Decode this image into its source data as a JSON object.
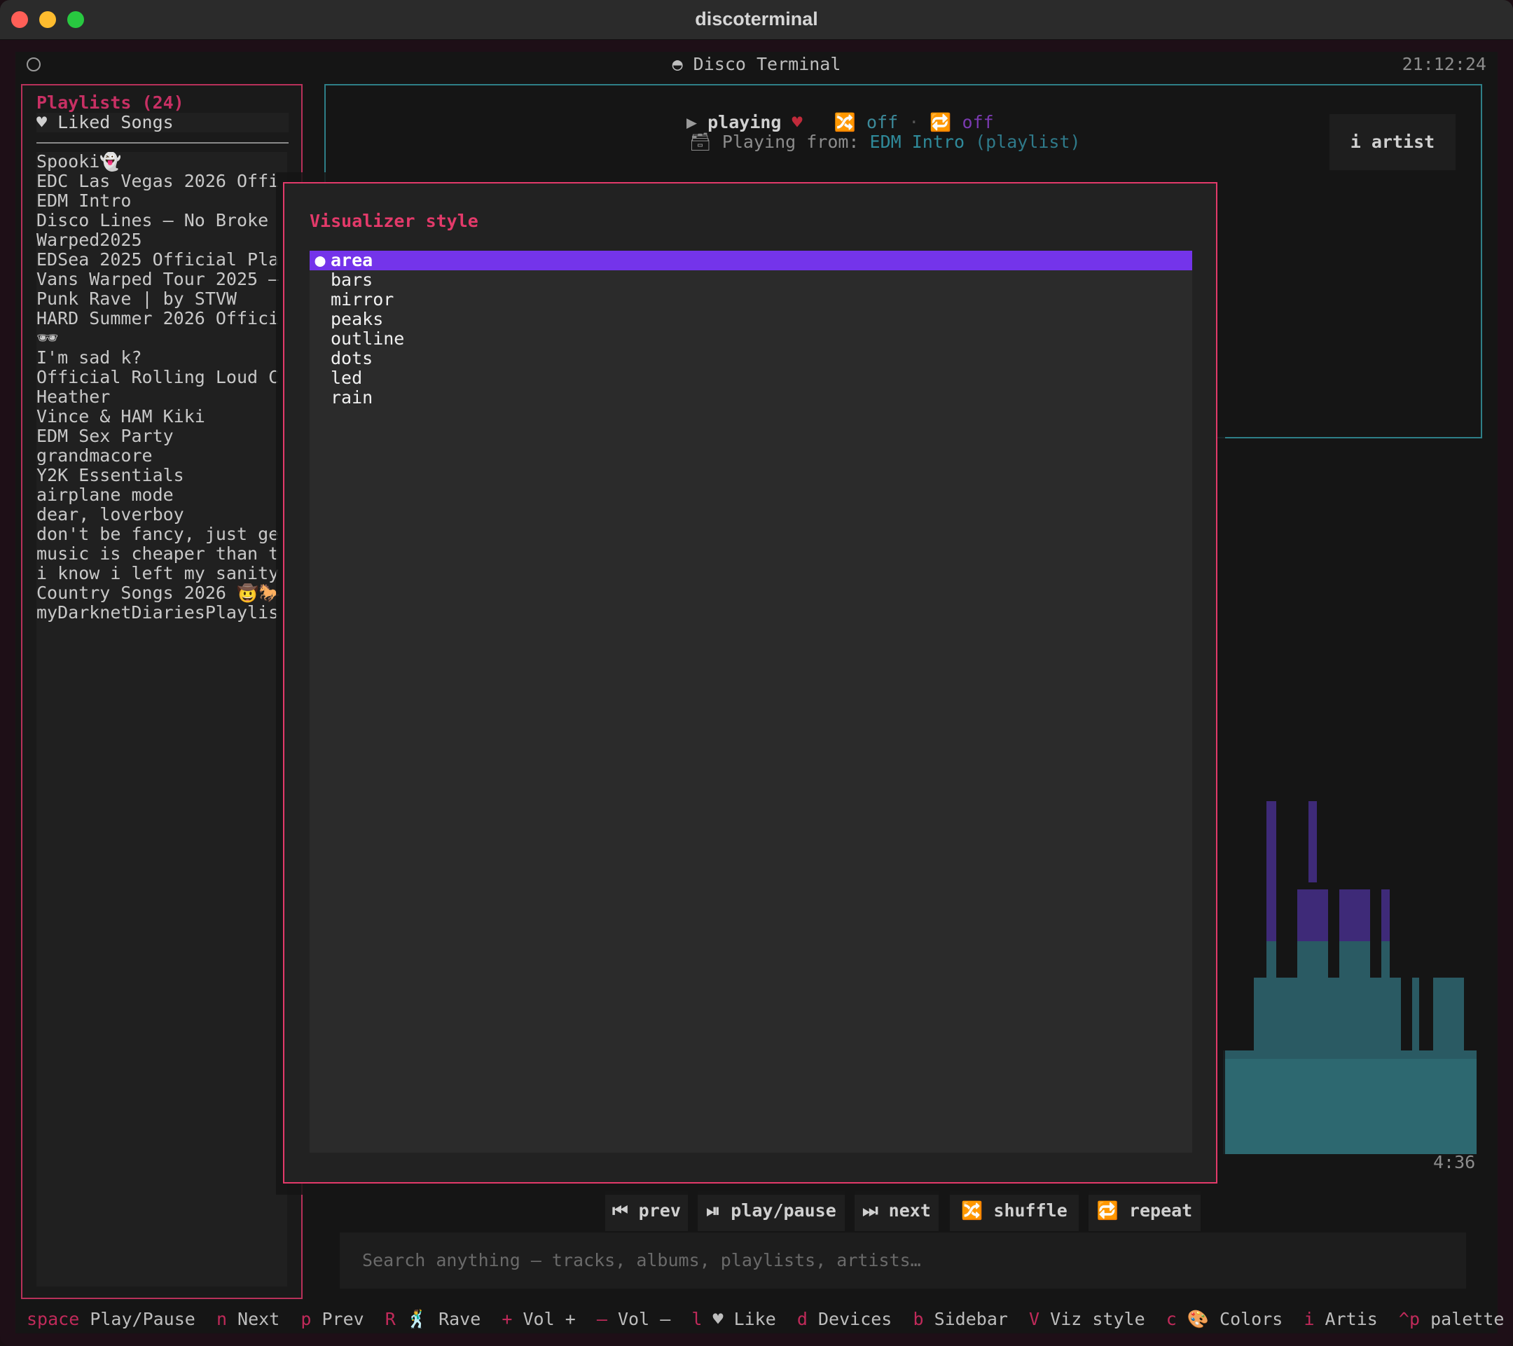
{
  "window": {
    "title": "discoterminal"
  },
  "header": {
    "app_title": "◓ Disco Terminal",
    "clock": "21:12:24"
  },
  "sidebar": {
    "title": "Playlists (24)",
    "liked": "♥ Liked Songs",
    "items": [
      "Spooki👻",
      "EDC Las Vegas 2026 Offi",
      "EDM Intro",
      "Disco Lines – No Broke",
      "Warped2025",
      "EDSea 2025 Official Pla",
      "Vans Warped Tour 2025 –",
      "Punk Rave | by STVW",
      "HARD Summer 2026 Offici",
      "🕶",
      "I'm sad k?",
      "Official Rolling Loud C",
      "Heather",
      "Vince & HAM Kiki",
      "EDM Sex Party",
      "grandmacore",
      "Y2K Essentials",
      "airplane mode",
      "dear, loverboy",
      "don't be fancy, just ge",
      "music is cheaper than t",
      "i know i left my sanity",
      "Country Songs 2026   🤠🐎",
      "myDarknetDiariesPlaylis"
    ]
  },
  "now_playing": {
    "state_icon": "▶",
    "state": "playing",
    "heart": "♥",
    "shuffle_icon": "🔀",
    "shuffle": "off",
    "sep": "·",
    "repeat_icon": "🔁",
    "repeat": "off",
    "source_icon": "🗃",
    "source_label": "Playing from:",
    "source_name": "EDM Intro",
    "source_type": "(playlist)",
    "artist_button": "i artist",
    "time_end": "4:36"
  },
  "controls": {
    "prev": "⏮ prev",
    "play_pause": "⏯ play/pause",
    "next": "⏭ next",
    "shuffle": "🔀 shuffle",
    "repeat": "🔁 repeat"
  },
  "search": {
    "placeholder": "Search anything — tracks, albums, playlists, artists…"
  },
  "footer": {
    "hints": [
      {
        "key": "space",
        "label": "Play/Pause"
      },
      {
        "key": "n",
        "label": "Next"
      },
      {
        "key": "p",
        "label": "Prev"
      },
      {
        "key": "R",
        "label": "🕺 Rave"
      },
      {
        "key": "+",
        "label": "Vol +"
      },
      {
        "key": "–",
        "label": "Vol –"
      },
      {
        "key": "l",
        "label": "♥ Like"
      },
      {
        "key": "d",
        "label": "Devices"
      },
      {
        "key": "b",
        "label": "Sidebar"
      },
      {
        "key": "V",
        "label": "Viz style"
      },
      {
        "key": "c",
        "label": "🎨 Colors"
      },
      {
        "key": "i",
        "label": "Artis"
      },
      {
        "key": "^p",
        "label": "palette"
      }
    ]
  },
  "modal": {
    "title": "Visualizer style",
    "selected_bullet": "●",
    "options": [
      "area",
      "bars",
      "mirror",
      "peaks",
      "outline",
      "dots",
      "led",
      "rain"
    ],
    "selected_index": 0
  },
  "visualizer": {
    "colors": {
      "low": "#2d6870",
      "mid": "#2a5a63",
      "high": "#3e2a78"
    }
  },
  "colors": {
    "accent": "#e33a6a",
    "selection": "#7434ea",
    "teal": "#2e7f88"
  }
}
